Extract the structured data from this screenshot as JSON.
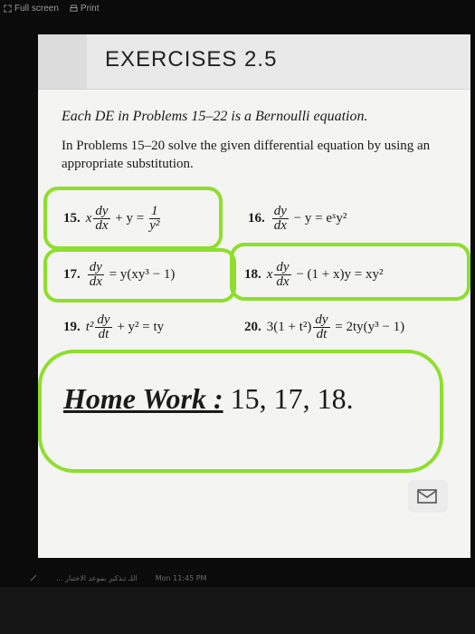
{
  "toolbar": {
    "fullscreen_label": "Full screen",
    "print_label": "Print"
  },
  "section": {
    "title": "EXERCISES 2.5",
    "intro_line1": "Each DE in Problems 15–22 is a Bernoulli equation.",
    "intro_line2": "In Problems 15–20 solve the given differential equation by using an appropriate substitution."
  },
  "problems": [
    {
      "number": "15.",
      "pre": "x",
      "dnum": "dy",
      "dden": "dx",
      "post": " + y = ",
      "rnum": "1",
      "rden": "y²"
    },
    {
      "number": "16.",
      "pre": "",
      "dnum": "dy",
      "dden": "dx",
      "post": " − y = eˣy²"
    },
    {
      "number": "17.",
      "pre": "",
      "dnum": "dy",
      "dden": "dx",
      "post": " = y(xy³ − 1)"
    },
    {
      "number": "18.",
      "pre": "x",
      "dnum": "dy",
      "dden": "dx",
      "post": " − (1 + x)y = xy²"
    },
    {
      "number": "19.",
      "pre": "t²",
      "dnum": "dy",
      "dden": "dt",
      "post": " + y² = ty"
    },
    {
      "number": "20.",
      "pre": "3(1 + t²)",
      "dnum": "dy",
      "dden": "dt",
      "post": " = 2ty(y³ − 1)"
    }
  ],
  "homework": {
    "label": "Home Work :",
    "value": " 15, 17, 18."
  },
  "status": {
    "text_rtl": "اللـ تـذكير بموعد الاختبار ...",
    "time": "Mon 11:45 PM"
  },
  "colors": {
    "highlight": "#8ede2c",
    "background": "#0b0b0b",
    "page": "#f4f4f2"
  },
  "icons": [
    "fullscreen-icon",
    "print-icon",
    "mail-icon",
    "notification-icon"
  ]
}
